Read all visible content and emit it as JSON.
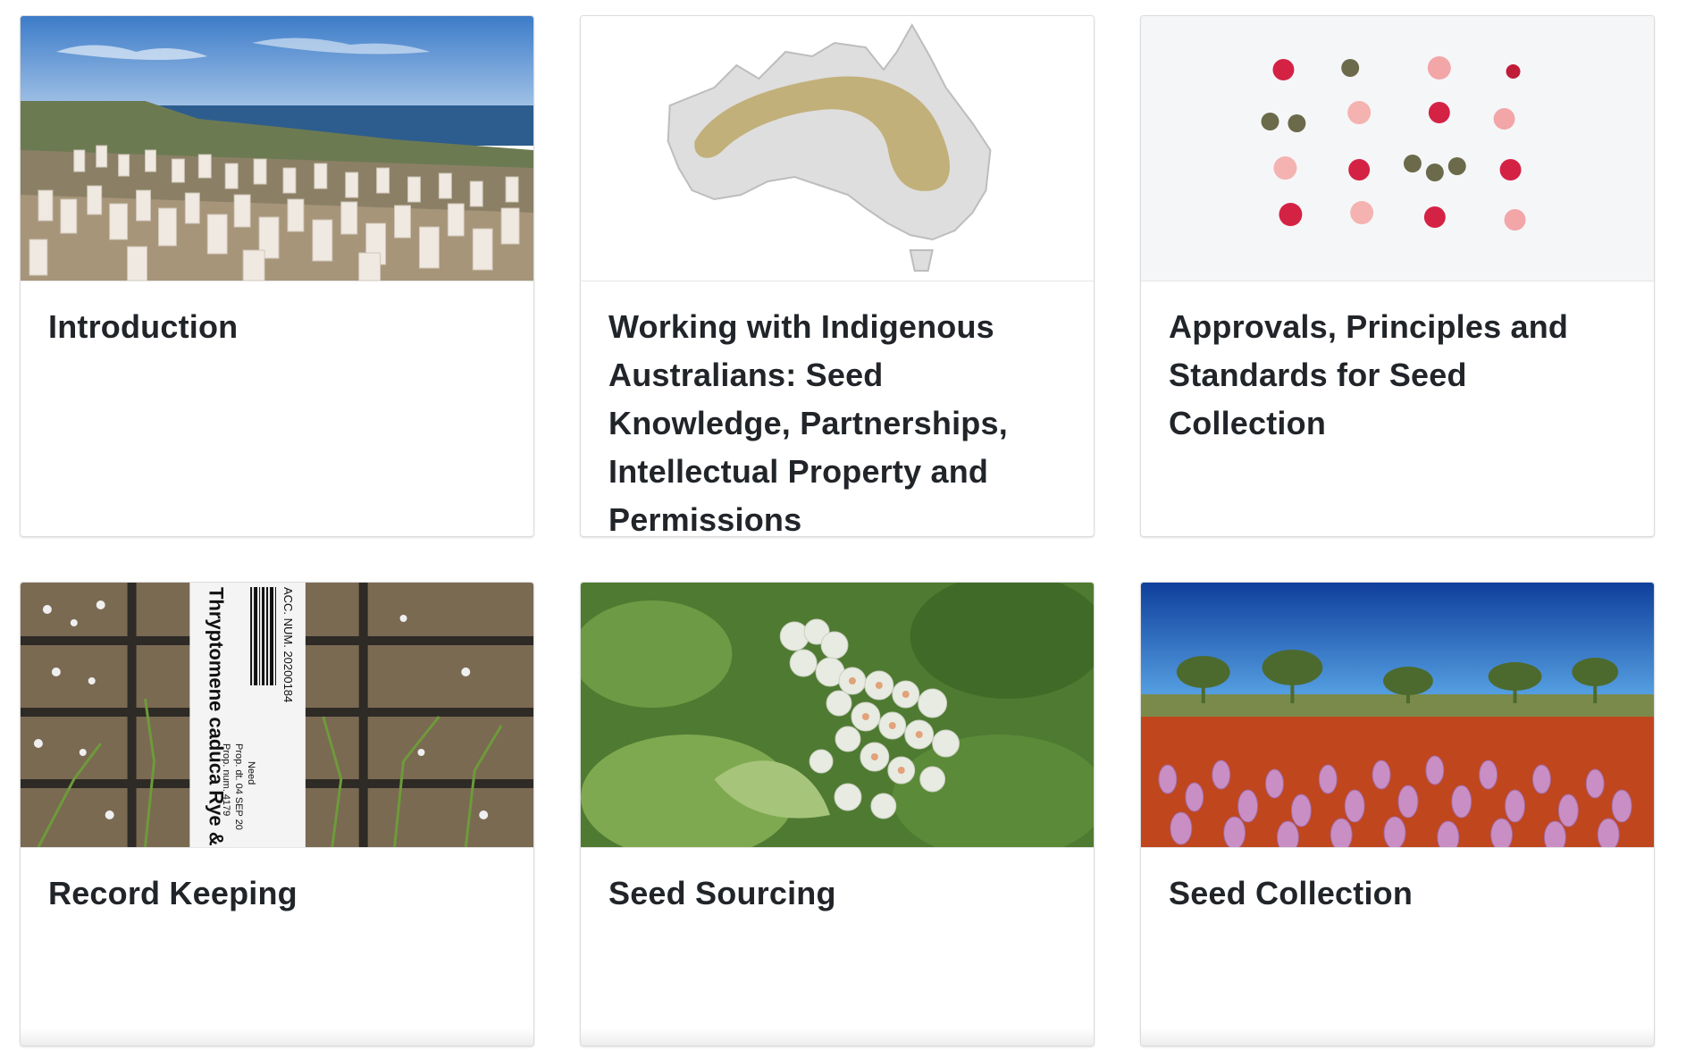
{
  "cards": [
    {
      "title": "Introduction"
    },
    {
      "title": "Working with Indigenous Australians: Seed Knowledge, Partnerships, Intellectual Property and Permissions"
    },
    {
      "title": "Approvals, Principles and Standards for Seed Collection"
    },
    {
      "title": "Record Keeping"
    },
    {
      "title": "Seed Sourcing"
    },
    {
      "title": "Seed Collection"
    }
  ],
  "images": {
    "record_label_lines": [
      "Thryptomene caduca Rye & Trudgen",
      "ACC. NUM. 20200184",
      "Prop. dt. 04 SEP 20",
      "Prop. num. 4179",
      "Need"
    ]
  },
  "colors": {
    "title_text": "#212529",
    "card_border": "#dcdcdc",
    "map_land": "#d9d9d9",
    "map_region": "#c2b07a",
    "sky_blue": "#1f5fb8",
    "red_soil": "#c0461e",
    "mulla_pink": "#c98fc4"
  }
}
